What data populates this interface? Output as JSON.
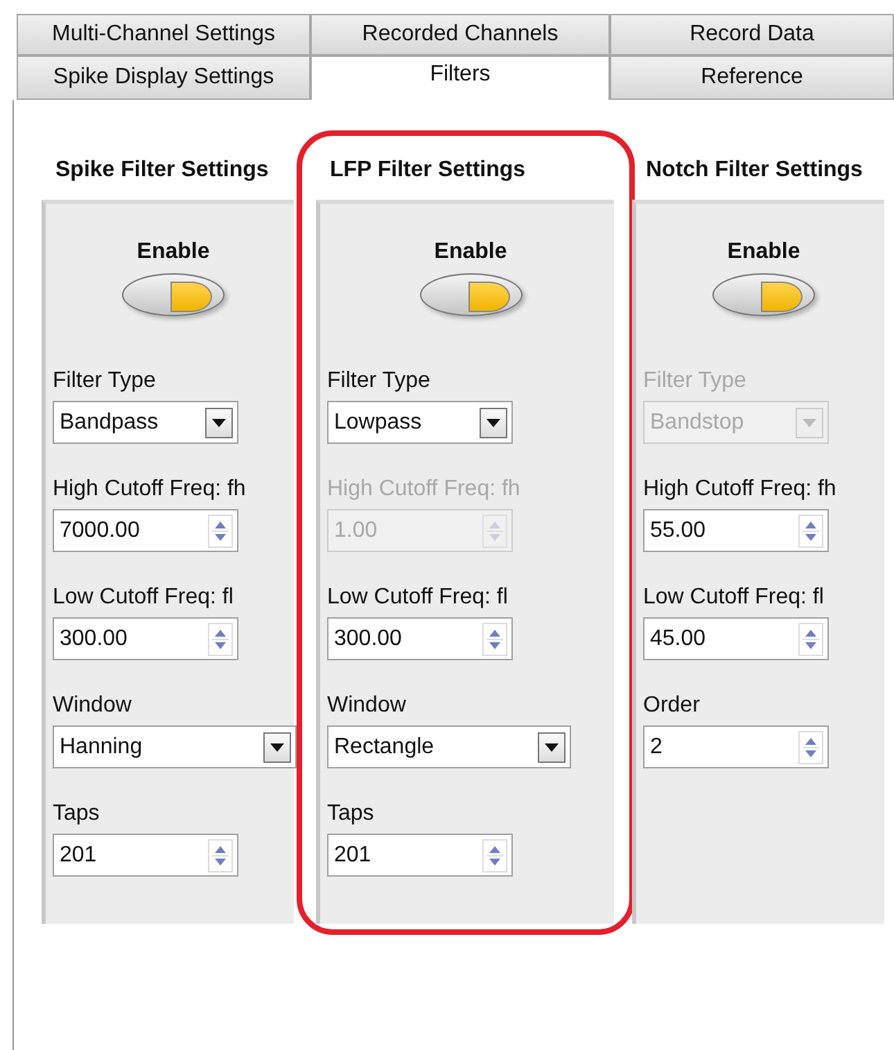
{
  "tabs": [
    [
      {
        "label": "Multi-Channel Settings",
        "selected": false
      },
      {
        "label": "Recorded Channels",
        "selected": false
      },
      {
        "label": "Record Data",
        "selected": false
      }
    ],
    [
      {
        "label": "Spike Display Settings",
        "selected": false
      },
      {
        "label": "Filters",
        "selected": true
      },
      {
        "label": "Reference",
        "selected": false
      }
    ]
  ],
  "panels": [
    {
      "title": "Spike Filter Settings",
      "highlighted": false,
      "enable_label": "Enable",
      "enabled": true,
      "fields": [
        {
          "kind": "combo",
          "label": "Filter Type",
          "value": "Bandpass",
          "disabled": false
        },
        {
          "kind": "spinner",
          "label": "High Cutoff Freq: fh",
          "value": "7000.00",
          "disabled": false
        },
        {
          "kind": "spinner",
          "label": "Low Cutoff Freq: fl",
          "value": "300.00",
          "disabled": false
        },
        {
          "kind": "widecombo",
          "label": "Window",
          "value": "Hanning",
          "disabled": false
        },
        {
          "kind": "spinner",
          "label": "Taps",
          "value": "201",
          "disabled": false
        }
      ]
    },
    {
      "title": "LFP Filter Settings",
      "highlighted": true,
      "enable_label": "Enable",
      "enabled": true,
      "fields": [
        {
          "kind": "combo",
          "label": "Filter Type",
          "value": "Lowpass",
          "disabled": false
        },
        {
          "kind": "spinner",
          "label": "High Cutoff Freq: fh",
          "value": "1.00",
          "disabled": true
        },
        {
          "kind": "spinner",
          "label": "Low Cutoff Freq: fl",
          "value": "300.00",
          "disabled": false
        },
        {
          "kind": "widecombo",
          "label": "Window",
          "value": "Rectangle",
          "disabled": false
        },
        {
          "kind": "spinner",
          "label": "Taps",
          "value": "201",
          "disabled": false
        }
      ]
    },
    {
      "title": "Notch Filter Settings",
      "highlighted": false,
      "enable_label": "Enable",
      "enabled": true,
      "fields": [
        {
          "kind": "combo",
          "label": "Filter Type",
          "value": "Bandstop",
          "disabled": true
        },
        {
          "kind": "spinner",
          "label": "High Cutoff Freq: fh",
          "value": "55.00",
          "disabled": false
        },
        {
          "kind": "spinner",
          "label": "Low Cutoff Freq: fl",
          "value": "45.00",
          "disabled": false
        },
        {
          "kind": "spinner",
          "label": "Order",
          "value": "2",
          "disabled": false
        }
      ]
    }
  ]
}
